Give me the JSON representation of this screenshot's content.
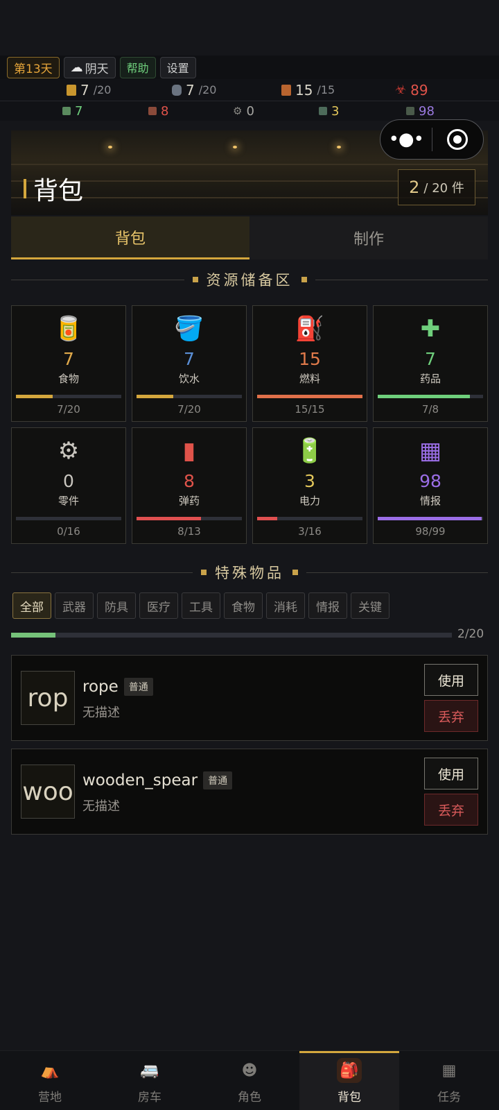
{
  "topbar": {
    "day": "第13天",
    "weather": "阴天",
    "weather_icon": "cloud-icon",
    "help": "帮助",
    "settings": "设置"
  },
  "stats_row1": [
    {
      "icon": "food-can-icon",
      "value": "7",
      "max": "/20",
      "color": "#d9d4c8",
      "icon_color": "#c9962e"
    },
    {
      "icon": "water-bottle-icon",
      "value": "7",
      "max": "/20",
      "color": "#d9d4c8",
      "icon_color": "#6a7380"
    },
    {
      "icon": "fuel-icon",
      "value": "15",
      "max": "/15",
      "color": "#d9d4c8",
      "icon_color": "#b8642f"
    },
    {
      "icon": "biohazard-icon",
      "value": "89",
      "max": "",
      "color": "#e0534a",
      "icon_color": "#c63a32"
    }
  ],
  "stats_row2": [
    {
      "icon": "parts-icon",
      "value": "7",
      "color": "#6fcf7c"
    },
    {
      "icon": "ammo-icon",
      "value": "8",
      "color": "#e0534a"
    },
    {
      "icon": "gear-icon",
      "value": "0",
      "color": "#a7a6a2"
    },
    {
      "icon": "battery-icon",
      "value": "3",
      "color": "#e3c75a"
    },
    {
      "icon": "intel-icon",
      "value": "98",
      "color": "#9b7ae0"
    }
  ],
  "banner": {
    "title": "背包",
    "count": "2",
    "count_suffix": "/ 20 件"
  },
  "tabs": [
    "背包",
    "制作"
  ],
  "resource_section_title": "资源储备区",
  "resources": [
    {
      "label": "食物",
      "value": "7",
      "cap": "7/20",
      "fill": 0.35,
      "color": "#e0a94a",
      "icon": "food-crate-icon",
      "glyph": "🥫"
    },
    {
      "label": "饮水",
      "value": "7",
      "cap": "7/20",
      "fill": 0.35,
      "color": "#5b8fd6",
      "icon": "water-bucket-icon",
      "glyph": "🪣"
    },
    {
      "label": "燃料",
      "value": "15",
      "cap": "15/15",
      "fill": 1.0,
      "color": "#e07a4a",
      "icon": "jerrycan-icon",
      "glyph": "⛽"
    },
    {
      "label": "药品",
      "value": "7",
      "cap": "7/8",
      "fill": 0.875,
      "color": "#6fcf7c",
      "icon": "first-aid-icon",
      "glyph": "✚"
    },
    {
      "label": "零件",
      "value": "0",
      "cap": "0/16",
      "fill": 0.0,
      "color": "#c9c6bf",
      "icon": "chain-parts-icon",
      "glyph": "⚙"
    },
    {
      "label": "弹药",
      "value": "8",
      "cap": "8/13",
      "fill": 0.615,
      "color": "#e0534a",
      "icon": "ammo-box-icon",
      "glyph": "▮"
    },
    {
      "label": "电力",
      "value": "3",
      "cap": "3/16",
      "fill": 0.1875,
      "color": "#e3c75a",
      "icon": "battery-icon",
      "glyph": "🔋"
    },
    {
      "label": "情报",
      "value": "98",
      "cap": "98/99",
      "fill": 0.99,
      "color": "#9b6ee6",
      "icon": "intel-files-icon",
      "glyph": "▦"
    }
  ],
  "resource_bar_colors": [
    "#d4a73d",
    "#d4a73d",
    "#e0704a",
    "#6fcf7c",
    "#3a3c44",
    "#e05050",
    "#e05050",
    "#9b6ee6"
  ],
  "special_section_title": "特殊物品",
  "filters": [
    "全部",
    "武器",
    "防具",
    "医疗",
    "工具",
    "食物",
    "消耗",
    "情报",
    "关键"
  ],
  "items_progress": {
    "label": "2/20",
    "fill": 0.1
  },
  "items": [
    {
      "thumb": "rop",
      "name": "rope",
      "rarity": "普通",
      "desc": "无描述",
      "use": "使用",
      "drop": "丢弃"
    },
    {
      "thumb": "woo",
      "name": "wooden_spear",
      "rarity": "普通",
      "desc": "无描述",
      "use": "使用",
      "drop": "丢弃"
    }
  ],
  "nav": [
    {
      "label": "营地",
      "icon": "camp-icon",
      "glyph": "⛺"
    },
    {
      "label": "房车",
      "icon": "rv-icon",
      "glyph": "🚐"
    },
    {
      "label": "角色",
      "icon": "character-icon",
      "glyph": "☻"
    },
    {
      "label": "背包",
      "icon": "backpack-icon",
      "glyph": "🎒",
      "active": true
    },
    {
      "label": "任务",
      "icon": "tasks-icon",
      "glyph": "▦"
    }
  ]
}
